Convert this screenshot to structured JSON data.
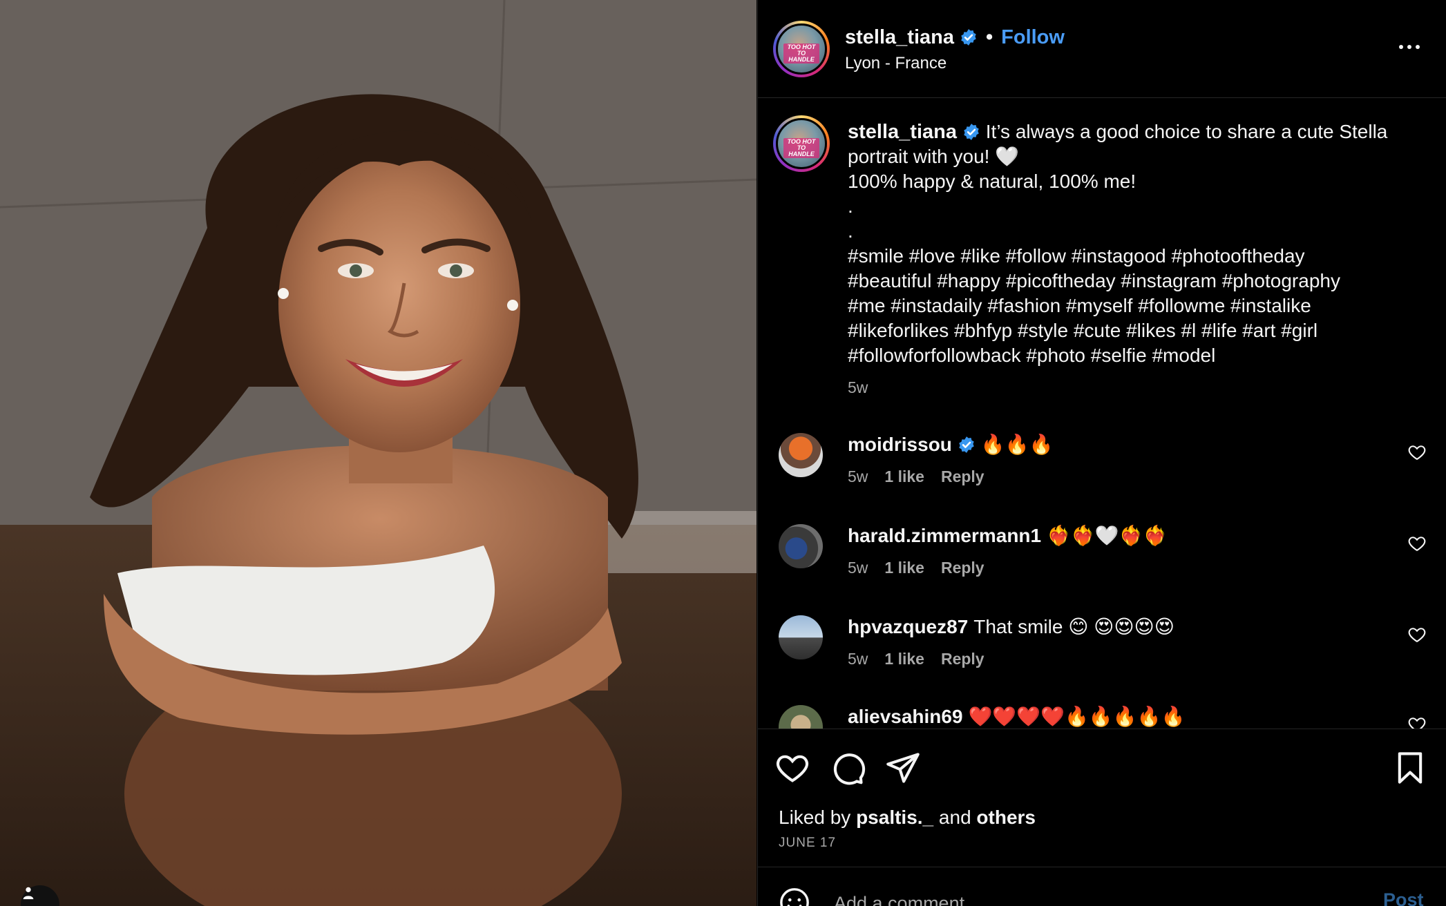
{
  "post": {
    "username": "stella_tiana",
    "follow_label": "Follow",
    "location": "Lyon - France",
    "avatar_badge": "TOO HOT TO HANDLE"
  },
  "caption": {
    "username": "stella_tiana",
    "text": "It’s always a good choice to share a cute Stella portrait with you! 🤍\n100% happy & natural, 100% me!\n.\n.\n#smile #love #like #follow #instagood #photooftheday\n#beautiful #happy #picoftheday #instagram #photography\n#me #instadaily #fashion #myself #followme #instalike\n#likeforlikes #bhfyp #style #cute #likes #l #life #art #girl\n#followforfollowback #photo #selfie #model",
    "time": "5w"
  },
  "comments": [
    {
      "username": "moidrissou",
      "verified": true,
      "text": "🔥🔥🔥",
      "time": "5w",
      "likes": "1 like",
      "reply": "Reply"
    },
    {
      "username": "harald.zimmermann1",
      "verified": false,
      "text": "❤️‍🔥❤️‍🔥🤍❤️‍🔥❤️‍🔥",
      "time": "5w",
      "likes": "1 like",
      "reply": "Reply"
    },
    {
      "username": "hpvazquez87",
      "verified": false,
      "text": "That smile 😊 😍😍😍😍",
      "time": "5w",
      "likes": "1 like",
      "reply": "Reply"
    },
    {
      "username": "alievsahin69",
      "verified": false,
      "text": "❤️❤️❤️❤️🔥🔥🔥🔥🔥",
      "time": "",
      "likes": "",
      "reply": ""
    }
  ],
  "actions": {
    "liked_by_prefix": "Liked by",
    "liked_by_user": "psaltis._",
    "liked_by_and": "and",
    "liked_by_others": "others",
    "date": "JUNE 17"
  },
  "add_comment": {
    "placeholder": "Add a comment...",
    "post_label": "Post"
  },
  "colors": {
    "link_blue": "#4a9cf6",
    "verified_blue": "#3897f0",
    "muted": "#a8a8a8",
    "post_disabled": "#2c5f91"
  },
  "icons": [
    "verified-badge-icon",
    "more-options-icon",
    "heart-icon",
    "comment-icon",
    "share-icon",
    "bookmark-icon",
    "emoji-icon",
    "user-tag-icon"
  ]
}
